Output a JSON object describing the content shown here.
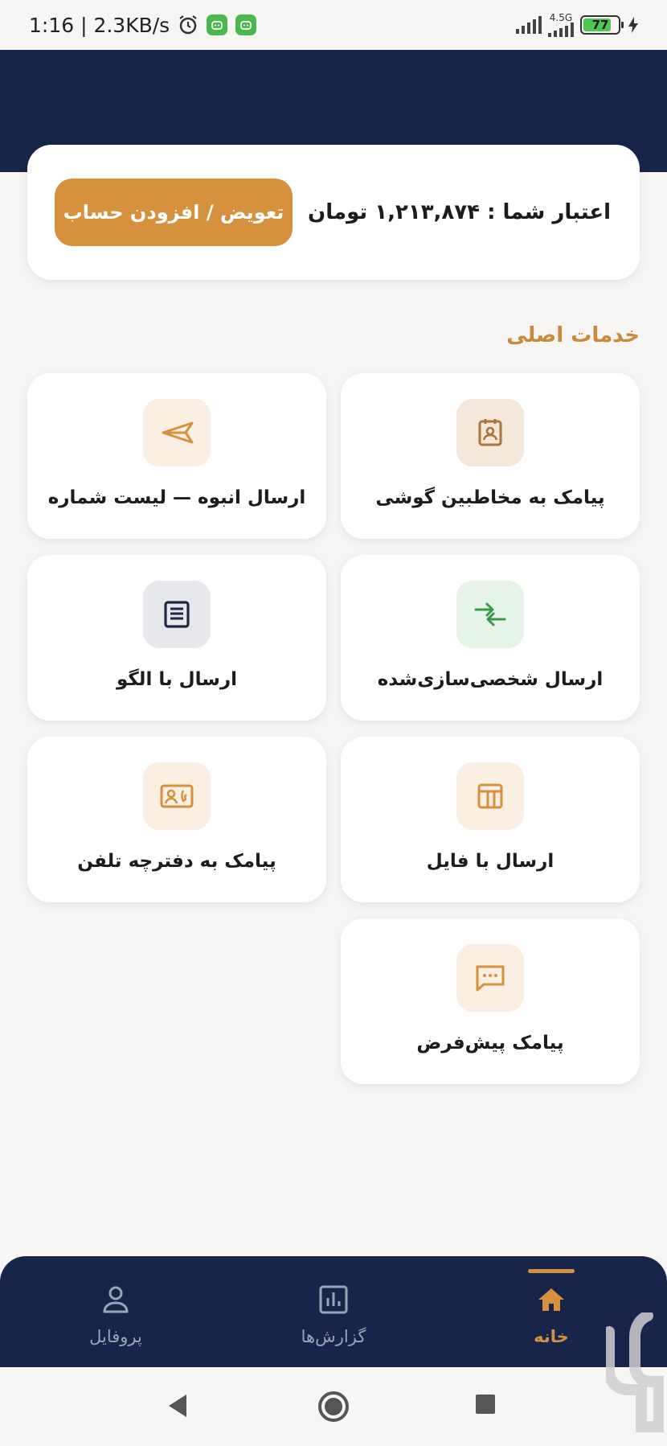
{
  "status_bar": {
    "time_speed": "1:16 | 2.3KB/s",
    "network": "4.5G",
    "battery": "77"
  },
  "credit": {
    "text": "اعتبار شما : ۱,۲۱۳,۸۷۴ تومان",
    "button_label": "تعویض / افزودن حساب"
  },
  "section_title": "خدمات اصلی",
  "services": [
    {
      "label": "پیامک به مخاطبین گوشی",
      "icon": "contact-badge-icon"
    },
    {
      "label": "ارسال انبوه — لیست شماره",
      "icon": "send-icon"
    },
    {
      "label": "ارسال شخصی‌سازی‌شده",
      "icon": "swap-arrows-icon"
    },
    {
      "label": "ارسال با الگو",
      "icon": "template-doc-icon"
    },
    {
      "label": "ارسال با فایل",
      "icon": "table-file-icon"
    },
    {
      "label": "پیامک به دفترچه تلفن",
      "icon": "phonebook-icon"
    },
    {
      "label": "پیامک پیش‌فرض",
      "icon": "message-bubble-icon"
    }
  ],
  "bottom_nav": [
    {
      "label": "خانه",
      "icon": "home-icon",
      "active": true
    },
    {
      "label": "گزارش‌ها",
      "icon": "reports-icon",
      "active": false
    },
    {
      "label": "پروفایل",
      "icon": "profile-icon",
      "active": false
    }
  ],
  "colors": {
    "primary_navy": "#17254a",
    "accent_orange": "#d6913e",
    "background": "#f7f6f4"
  }
}
